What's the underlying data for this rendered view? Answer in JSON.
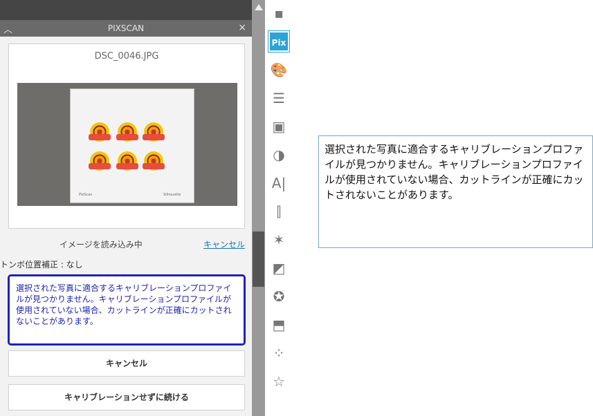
{
  "panel": {
    "title": "PIXSCAN",
    "collapse_icon": "▲",
    "close_icon": "×",
    "filename": "DSC_0046.JPG",
    "mat_label_left": "PixScan",
    "mat_label_right": "Silhouette",
    "loading_text": "イメージを読み込み中",
    "cancel_link": "キャンセル",
    "registration": "トンボ位置補正 : なし",
    "warning": "選択された写真に適合するキャリブレーションプロファイルが見つかりません。キャリブレーションプロファイルが使用されていない場合、カットラインが正確にカットされないことがあります。",
    "cancel_button": "キャンセル",
    "continue_button": "キャリブレーションせずに続ける"
  },
  "toolbar": {
    "items": [
      {
        "name": "page-setup-icon",
        "glyph": "▪"
      },
      {
        "name": "pixscan-icon",
        "glyph": "Pix"
      },
      {
        "name": "palette-icon",
        "glyph": "🎨"
      },
      {
        "name": "line-style-icon",
        "glyph": "☰"
      },
      {
        "name": "fill-pattern-icon",
        "glyph": "▣"
      },
      {
        "name": "contrast-icon",
        "glyph": "◑"
      },
      {
        "name": "text-icon",
        "glyph": "A|"
      },
      {
        "name": "align-icon",
        "glyph": "⫿"
      },
      {
        "name": "magic-wand-icon",
        "glyph": "✶"
      },
      {
        "name": "transform-icon",
        "glyph": "◩"
      },
      {
        "name": "star-replicate-icon",
        "glyph": "✪"
      },
      {
        "name": "trace-icon",
        "glyph": "⬒"
      },
      {
        "name": "dots-icon",
        "glyph": "⁘"
      },
      {
        "name": "star-outline-icon",
        "glyph": "☆"
      }
    ]
  },
  "message": {
    "text": "選択された写真に適合するキャリブレーションプロファイルが見つかりません。キャリブレーションプロファイルが使用されていない場合、カットラインが正確にカットされないことがあります。"
  },
  "colors": {
    "accent": "#2da3d6",
    "warning_border": "#1e22b8",
    "link": "#1a73b8"
  }
}
